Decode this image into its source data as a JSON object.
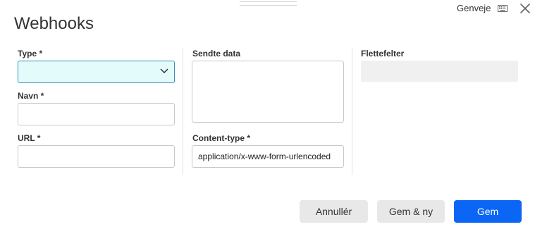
{
  "dialog": {
    "title": "Webhooks",
    "shortcut_label": "Genveje"
  },
  "form": {
    "type_label": "Type *",
    "type_value": "",
    "name_label": "Navn *",
    "name_value": "",
    "url_label": "URL *",
    "url_value": "",
    "sent_data_label": "Sendte data",
    "content_type_label": "Content-type *",
    "content_type_value": "application/x-www-form-urlencoded",
    "merge_fields_label": "Flettefelter"
  },
  "buttons": {
    "cancel": "Annullér",
    "save_new": "Gem & ny",
    "save": "Gem"
  },
  "colors": {
    "primary": "#0b66f5",
    "select_bg": "#e4fbfb",
    "select_border": "#3a8fb5"
  }
}
